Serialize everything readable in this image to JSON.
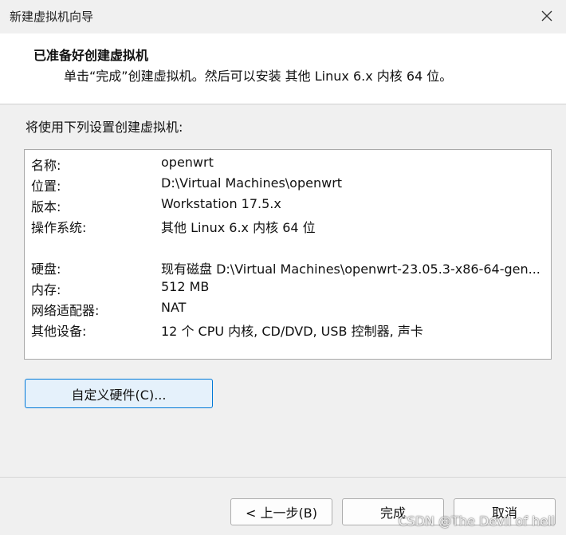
{
  "window": {
    "title": "新建虚拟机向导"
  },
  "header": {
    "title": "已准备好创建虚拟机",
    "subtitle": "单击“完成”创建虚拟机。然后可以安装 其他 Linux 6.x 内核 64 位。"
  },
  "intro": "将使用下列设置创建虚拟机:",
  "summary": {
    "rows": [
      {
        "key": "名称:",
        "value": "openwrt"
      },
      {
        "key": "位置:",
        "value": "D:\\Virtual Machines\\openwrt"
      },
      {
        "key": "版本:",
        "value": "Workstation 17.5.x"
      },
      {
        "key": "操作系统:",
        "value": "其他 Linux 6.x 内核 64 位"
      },
      {
        "key": "硬盘:",
        "value": "现有磁盘 D:\\Virtual Machines\\openwrt-23.05.3-x86-64-gen..."
      },
      {
        "key": "内存:",
        "value": "512 MB"
      },
      {
        "key": "网络适配器:",
        "value": "NAT"
      },
      {
        "key": "其他设备:",
        "value": "12 个 CPU 内核, CD/DVD, USB 控制器, 声卡"
      }
    ]
  },
  "buttons": {
    "customize": "自定义硬件(C)...",
    "back": "< 上一步(B)",
    "finish": "完成",
    "cancel": "取消"
  },
  "watermark": "CSDN @The Devil of hell",
  "icons": {
    "close": "close-icon"
  },
  "colors": {
    "focus_border": "#0078d7",
    "focus_fill": "#e5f1fb"
  }
}
